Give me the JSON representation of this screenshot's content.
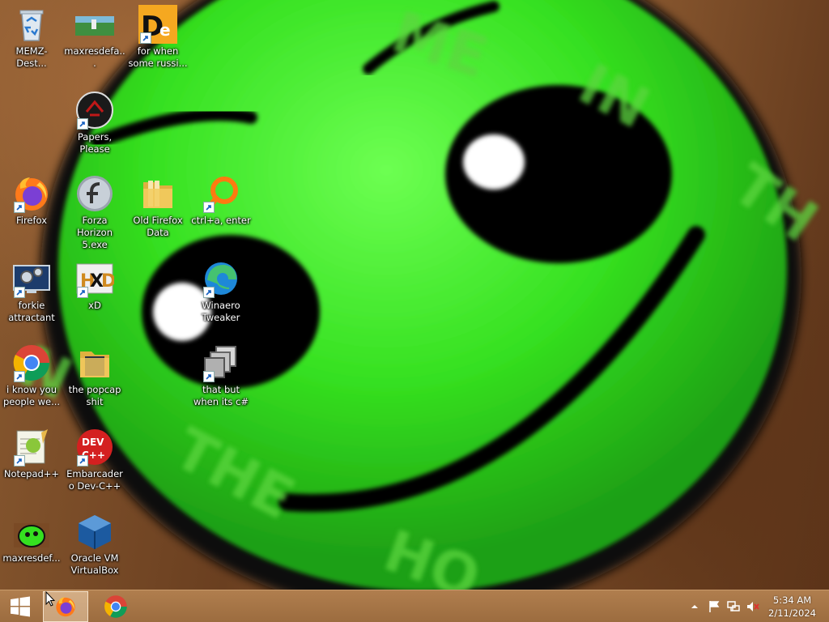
{
  "desktop": {
    "icons": [
      {
        "label": "MEMZ-Dest...",
        "icon": "recycle-bin-icon"
      },
      {
        "label": "maxresdefa...",
        "icon": "image-thumbnail-icon"
      },
      {
        "label": "for when some russi...",
        "icon": "de-app-icon"
      },
      {
        "label": "Papers, Please",
        "icon": "papers-please-icon"
      },
      {
        "label": "Firefox",
        "icon": "firefox-icon"
      },
      {
        "label": "Forza Horizon 5.exe",
        "icon": "flash-player-icon"
      },
      {
        "label": "Old Firefox Data",
        "icon": "folder-icon"
      },
      {
        "label": "ctrl+a, enter",
        "icon": "magnifier-icon"
      },
      {
        "label": "forkie attractant",
        "icon": "settings-monitor-icon"
      },
      {
        "label": "xD",
        "icon": "hxd-icon"
      },
      {
        "label": "Winaero Tweaker",
        "icon": "edge-icon"
      },
      {
        "label": "i know you people we...",
        "icon": "chrome-icon"
      },
      {
        "label": "the popcap shit",
        "icon": "folder-icon"
      },
      {
        "label": "that but when its c#",
        "icon": "stacked-windows-icon"
      },
      {
        "label": "Notepad++",
        "icon": "notepadpp-icon"
      },
      {
        "label": "Embarcadero Dev-C++",
        "icon": "devcpp-icon"
      },
      {
        "label": "maxresdef...",
        "icon": "green-face-icon"
      },
      {
        "label": "Oracle VM VirtualBox",
        "icon": "virtualbox-icon"
      }
    ]
  },
  "taskbar": {
    "start": "windows-start-icon",
    "pinned": [
      "firefox-icon",
      "chrome-icon"
    ],
    "tray": [
      "show-hidden-icons-icon",
      "action-center-flag-icon",
      "network-icon",
      "volume-muted-icon"
    ],
    "time": "5:34 AM",
    "date": "2/11/2024"
  },
  "colors": {
    "face_green": "#35e020",
    "taskbar": "#a8774a"
  }
}
